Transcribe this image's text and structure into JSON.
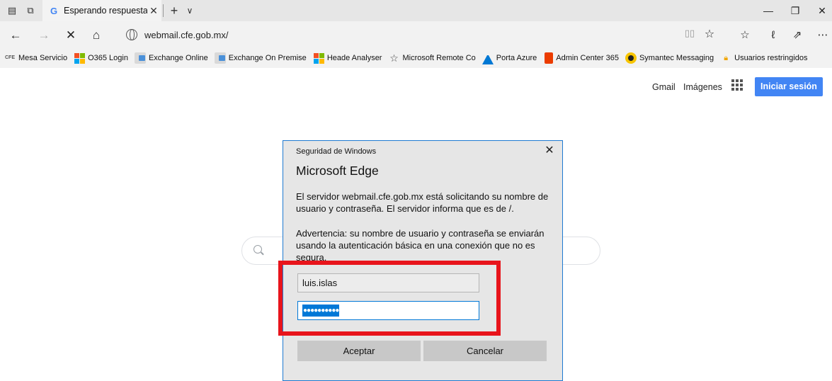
{
  "browser": {
    "tab_title": "Esperando respuesta de",
    "tab_favicon": "G",
    "url": "webmail.cfe.gob.mx/"
  },
  "favorites": [
    {
      "label": "Mesa Servicio",
      "icon": "cfe-icon"
    },
    {
      "label": "O365 Login",
      "icon": "microsoft-logo-icon"
    },
    {
      "label": "Exchange Online",
      "icon": "exchange-icon"
    },
    {
      "label": "Exchange On Premise",
      "icon": "exchange-icon"
    },
    {
      "label": "Heade Analyser",
      "icon": "microsoft-logo-icon"
    },
    {
      "label": "Microsoft Remote Co",
      "icon": "star-icon"
    },
    {
      "label": "Porta Azure",
      "icon": "azure-icon"
    },
    {
      "label": "Admin Center 365",
      "icon": "office-icon"
    },
    {
      "label": "Symantec Messaging",
      "icon": "symantec-icon"
    },
    {
      "label": "Usuarios restringidos",
      "icon": "lock-icon"
    }
  ],
  "page": {
    "gmail": "Gmail",
    "images": "Imágenes",
    "signin": "Iniciar sesión",
    "signin_color": "#4285f4"
  },
  "dialog": {
    "caption": "Seguridad de Windows",
    "title": "Microsoft Edge",
    "message": "El servidor webmail.cfe.gob.mx está solicitando su nombre de usuario y contraseña. El servidor informa que es de /.",
    "warning": "Advertencia: su nombre de usuario y contraseña se enviarán usando la autenticación básica en una conexión que no es segura.",
    "username": "luis.islas",
    "password_mask": "●●●●●●●●●●",
    "ok_label": "Aceptar",
    "cancel_label": "Cancelar",
    "highlight_color": "#e8141b"
  }
}
